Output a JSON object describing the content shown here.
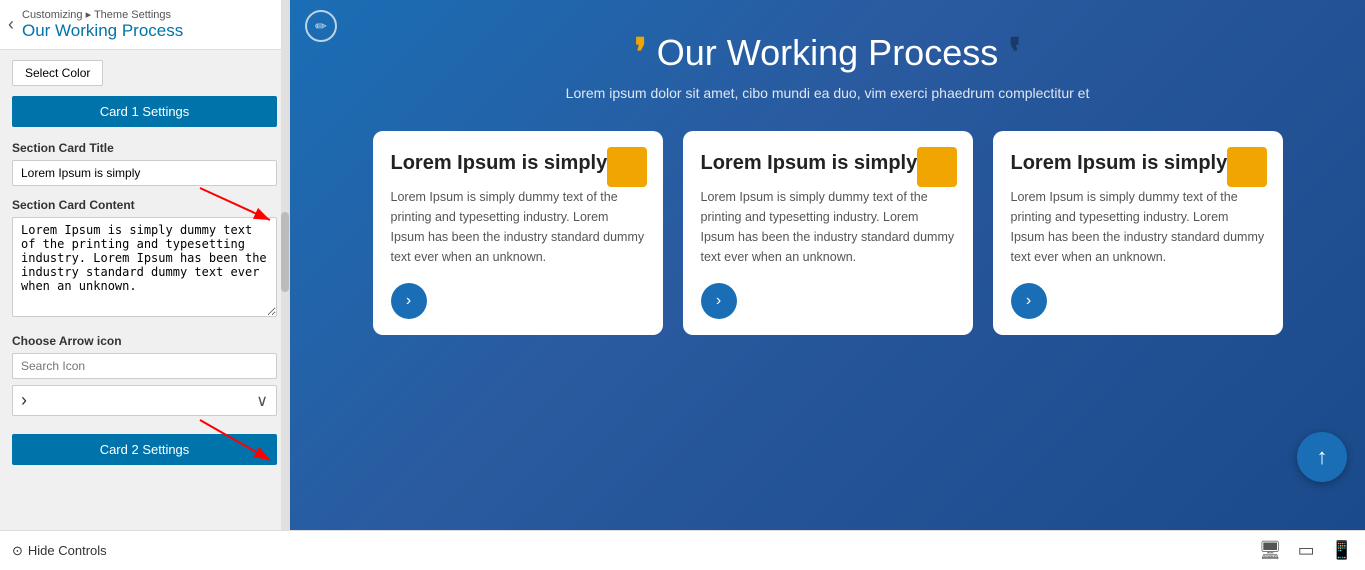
{
  "header": {
    "breadcrumb": "Customizing ▸ Theme Settings",
    "title": "Our Working Process",
    "back_label": "‹"
  },
  "panel": {
    "select_color_label": "Select Color",
    "card1_btn_label": "Card 1 Settings",
    "section_card_title_label": "Section Card Title",
    "section_card_title_value": "Lorem Ipsum is simply",
    "section_card_content_label": "Section Card Content",
    "section_card_content_value": "Lorem Ipsum is simply dummy text of the printing and typesetting industry. Lorem Ipsum has been the industry standard dummy text ever when an unknown.",
    "choose_arrow_icon_label": "Choose Arrow icon",
    "search_icon_placeholder": "Search Icon",
    "icon_char": "›",
    "chevron_down": "∨",
    "card2_btn_label": "Card 2 Settings"
  },
  "preview": {
    "section_title": "Our Working Process",
    "section_subtitle": "Lorem ipsum dolor sit amet, cibo mundi ea duo, vim exerci phaedrum complectitur et",
    "heading_icon_left": "❜",
    "heading_icon_right": "❜",
    "cards": [
      {
        "title": "Lorem Ipsum is simply",
        "body": "Lorem Ipsum is simply dummy text of the printing and typesetting industry. Lorem Ipsum has been the industry standard dummy text ever when an unknown.",
        "arrow": "›"
      },
      {
        "title": "Lorem Ipsum is simply",
        "body": "Lorem Ipsum is simply dummy text of the printing and typesetting industry. Lorem Ipsum has been the industry standard dummy text ever when an unknown.",
        "arrow": "›"
      },
      {
        "title": "Lorem Ipsum is simply",
        "body": "Lorem Ipsum is simply dummy text of the printing and typesetting industry. Lorem Ipsum has been the industry standard dummy text ever when an unknown.",
        "arrow": "›"
      }
    ]
  },
  "bottom_bar": {
    "hide_controls_label": "Hide Controls",
    "eye_icon": "●",
    "desktop_icon": "🖥",
    "tablet_icon": "▭",
    "phone_icon": "📱"
  },
  "upload_btn_icon": "↑"
}
